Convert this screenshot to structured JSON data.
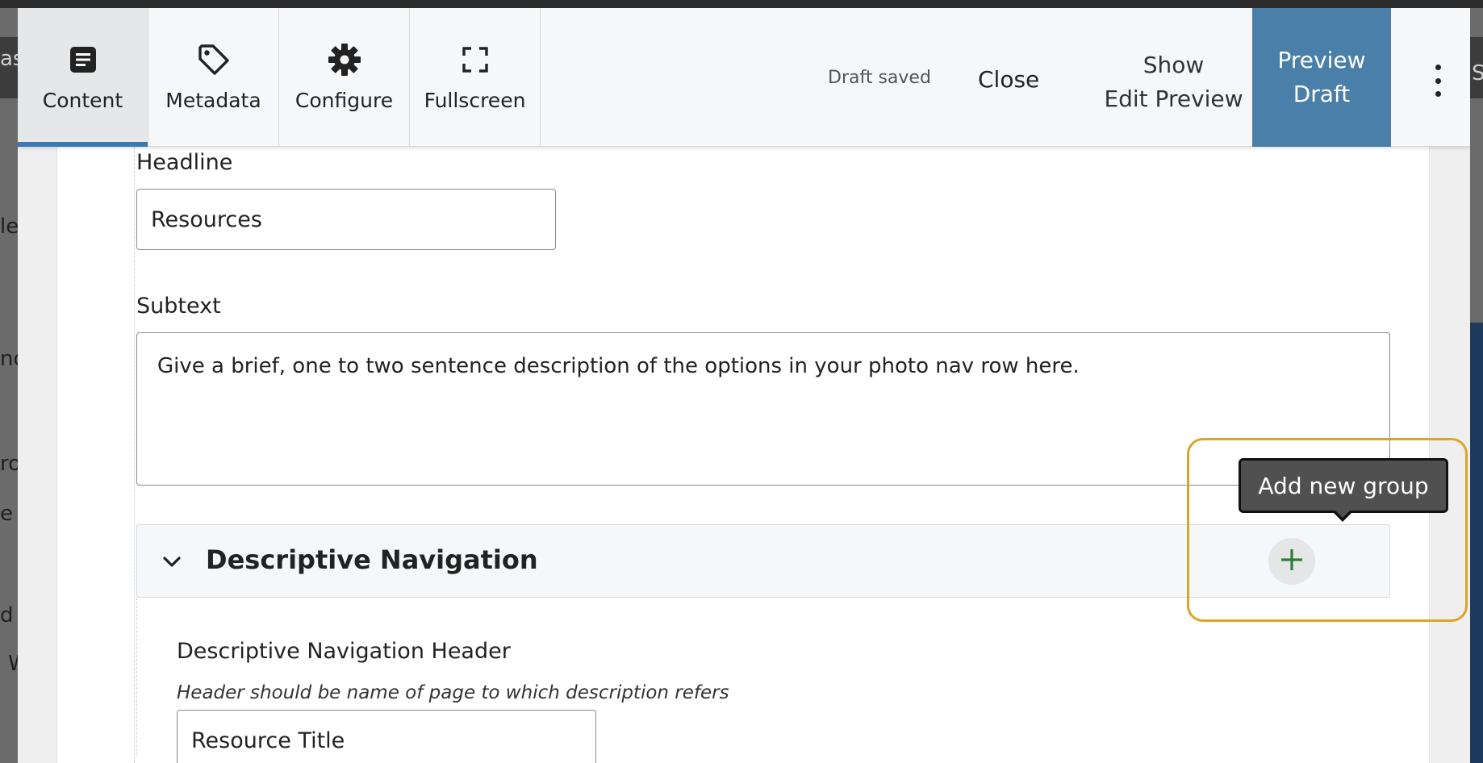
{
  "toolbar": {
    "tabs": [
      {
        "label": "Content",
        "icon": "content-icon",
        "active": true
      },
      {
        "label": "Metadata",
        "icon": "tag-icon",
        "active": false
      },
      {
        "label": "Configure",
        "icon": "gear-icon",
        "active": false
      },
      {
        "label": "Fullscreen",
        "icon": "fullscreen-icon",
        "active": false
      }
    ],
    "draft_status": "Draft saved",
    "close_label": "Close",
    "show_preview_line1": "Show",
    "show_preview_line2": "Edit Preview",
    "preview_draft_line1": "Preview",
    "preview_draft_line2": "Draft",
    "more_icon": "more-vertical-icon",
    "accent_color": "#497fa9"
  },
  "form": {
    "headline_label": "Headline",
    "headline_value": "Resources",
    "subtext_label": "Subtext",
    "subtext_value": "Give a brief, one to two sentence description of the options in your photo nav row here.",
    "group": {
      "title": "Descriptive Navigation",
      "chevron_icon": "chevron-down-icon",
      "add_icon": "plus-icon",
      "tooltip": "Add new group",
      "header_label": "Descriptive Navigation Header",
      "header_help": "Header should be name of page to which description refers",
      "header_value": "Resource Title"
    }
  },
  "background": {
    "left_fragments": [
      "as",
      "le",
      "nd",
      "ro",
      "e",
      "d",
      "W"
    ],
    "right_fragment": "S"
  }
}
